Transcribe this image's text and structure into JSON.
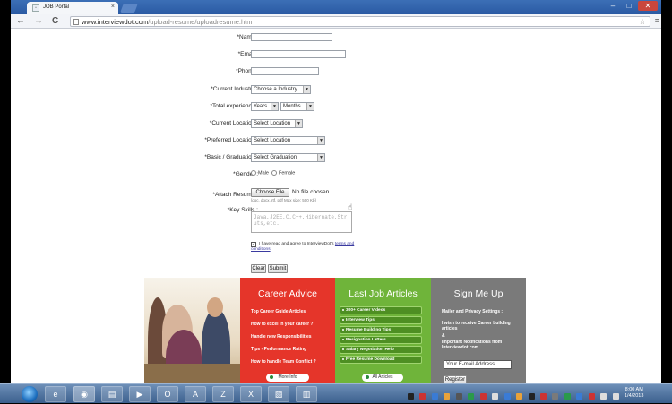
{
  "browser": {
    "tab_title": "JOB Portal",
    "url_host": "www.interviewdot.com",
    "url_path": "/upload-resume/uploadresume.htm",
    "controls": {
      "back": "←",
      "forward": "→",
      "reload": "C",
      "close_tab": "×",
      "minimize": "–",
      "maximize": "□",
      "close": "✕"
    }
  },
  "form": {
    "name_label": "*Name :",
    "email_label": "*Email :",
    "phone_label": "*Phone :",
    "industry_label": "*Current Industry :",
    "industry_value": "Choose a Industry",
    "experience_label": "*Total experience :",
    "years_value": "Years",
    "months_value": "Months",
    "location_label": "*Current Location :",
    "location_value": "Select Location",
    "pref_location_label": "*Preferred Location :",
    "pref_location_value": "Select Location",
    "graduation_label": "*Basic / Graduation :",
    "graduation_value": "Select Graduation",
    "gender_label": "*Gender :",
    "gender_male": "Male",
    "gender_female": "Female",
    "resume_label": "*Attach Resume :",
    "choose_file": "Choose File",
    "no_file": "No file chosen",
    "file_hint": "[doc, docx, rtf, pdf Max size: 500 Kb]",
    "skills_label": "*Key Skills :",
    "skills_placeholder": "Java,J2EE,C,C++,Hibernate,Struts,etc.",
    "agree_text": "I have read and agree to InterviewDot's",
    "terms_link": "terms and conditions",
    "clear_button": "Clear",
    "submit_button": "Submit"
  },
  "footer": {
    "career": {
      "title": "Career Advice",
      "links": [
        "Top Career Guide Articles",
        "How to excel in your career ?",
        "Handle new Responsibilities",
        "Tips - Performance Rating",
        "How to handle Team Conflict ?"
      ],
      "more": "More Info"
    },
    "lastjob": {
      "title": "Last Job Articles",
      "links": [
        "300+ Career Videos",
        "Interview Tips",
        "Resume Building Tips",
        "Resignation Letters",
        "Salary Negotiation Help",
        "Free Resume Download"
      ],
      "more": "All Articles"
    },
    "signup": {
      "title": "Sign Me Up",
      "line1": "Mailer and Privacy Settings :",
      "line2": "I wish to receive Career building articles",
      "line3": "&",
      "line4": "Important Notifications from Interviewdot.com",
      "email_value": "Your E-mail Address",
      "register": "Register"
    }
  },
  "taskbar": {
    "time": "8:00 AM",
    "date": "1/4/2013"
  }
}
